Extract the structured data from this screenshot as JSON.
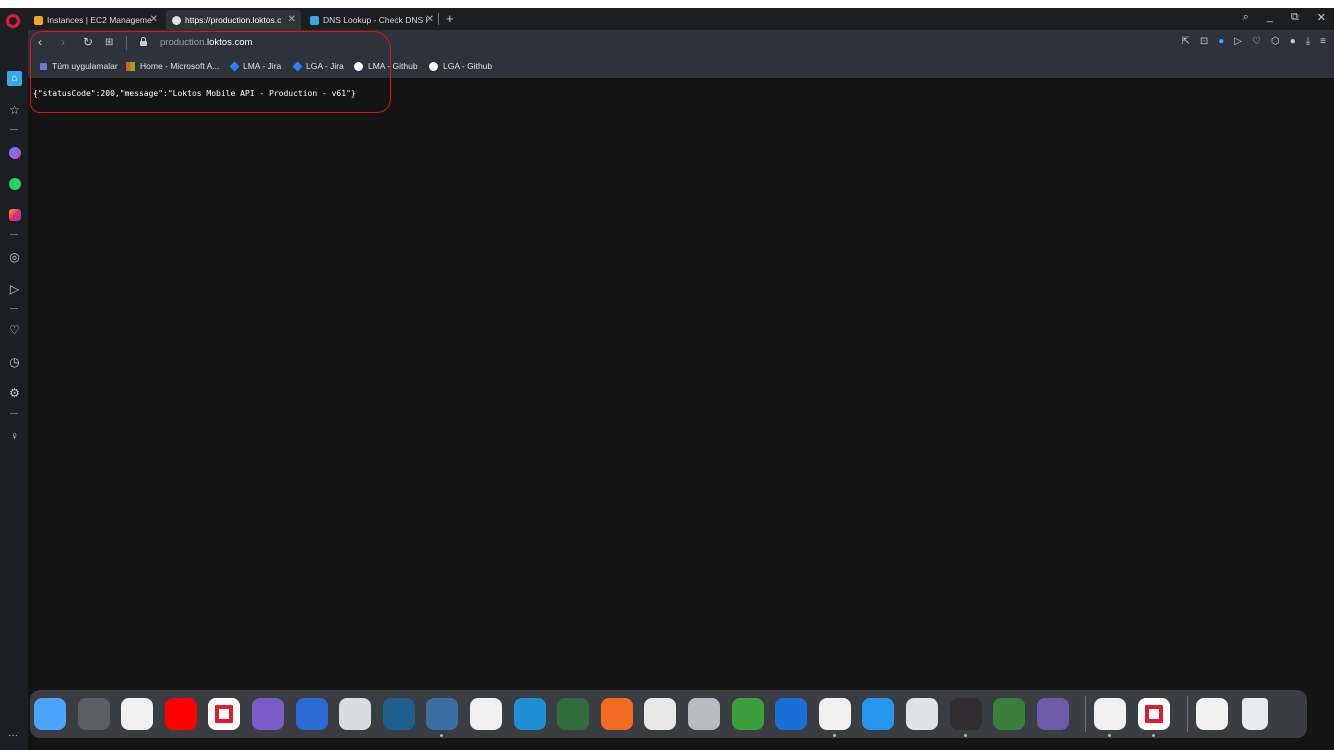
{
  "tabs": [
    {
      "title": "Instances | EC2 Manageme",
      "active": false
    },
    {
      "title": "https://production.loktos.c",
      "active": true
    },
    {
      "title": "DNS Lookup - Check DNS I",
      "active": false
    }
  ],
  "address_bar": {
    "url_prefix": "production.",
    "url_domain": "loktos.com"
  },
  "bookmarks": [
    {
      "label": "Tüm uygulamalar",
      "icon": "apps-grid-icon"
    },
    {
      "label": "Home - Microsoft A...",
      "icon": "microsoft-icon"
    },
    {
      "label": "LMA - Jira",
      "icon": "jira-icon"
    },
    {
      "label": "LGA - Jira",
      "icon": "jira-icon"
    },
    {
      "label": "LMA - Github",
      "icon": "github-icon"
    },
    {
      "label": "LGA - Github",
      "icon": "github-icon"
    }
  ],
  "page": {
    "json_response": "{\"statusCode\":200,\"message\":\"Loktos Mobile API - Production - v61\"}"
  },
  "colors": {
    "annotation": "#e01313",
    "opera_red": "#e01d2d",
    "page_bg": "#141414"
  },
  "dock_apps": [
    "finder-icon",
    "settings-icon",
    "launchpad-icon",
    "youtube-icon",
    "opera-icon",
    "visual-studio-icon",
    "audio-icon",
    "git-icon",
    "network-icon",
    "postman-icon",
    "slack-icon",
    "vscode-icon",
    "android-studio-icon",
    "postman-alt-icon",
    "paint-icon",
    "unity-icon",
    "bluestacks-icon",
    "remote-icon",
    "satellite-icon",
    "docker-icon",
    "gimp-icon",
    "obs-icon",
    "vpn-icon",
    "avatar-icon",
    "slack-icon",
    "opera-icon",
    "windows-icon",
    "trash-icon"
  ]
}
